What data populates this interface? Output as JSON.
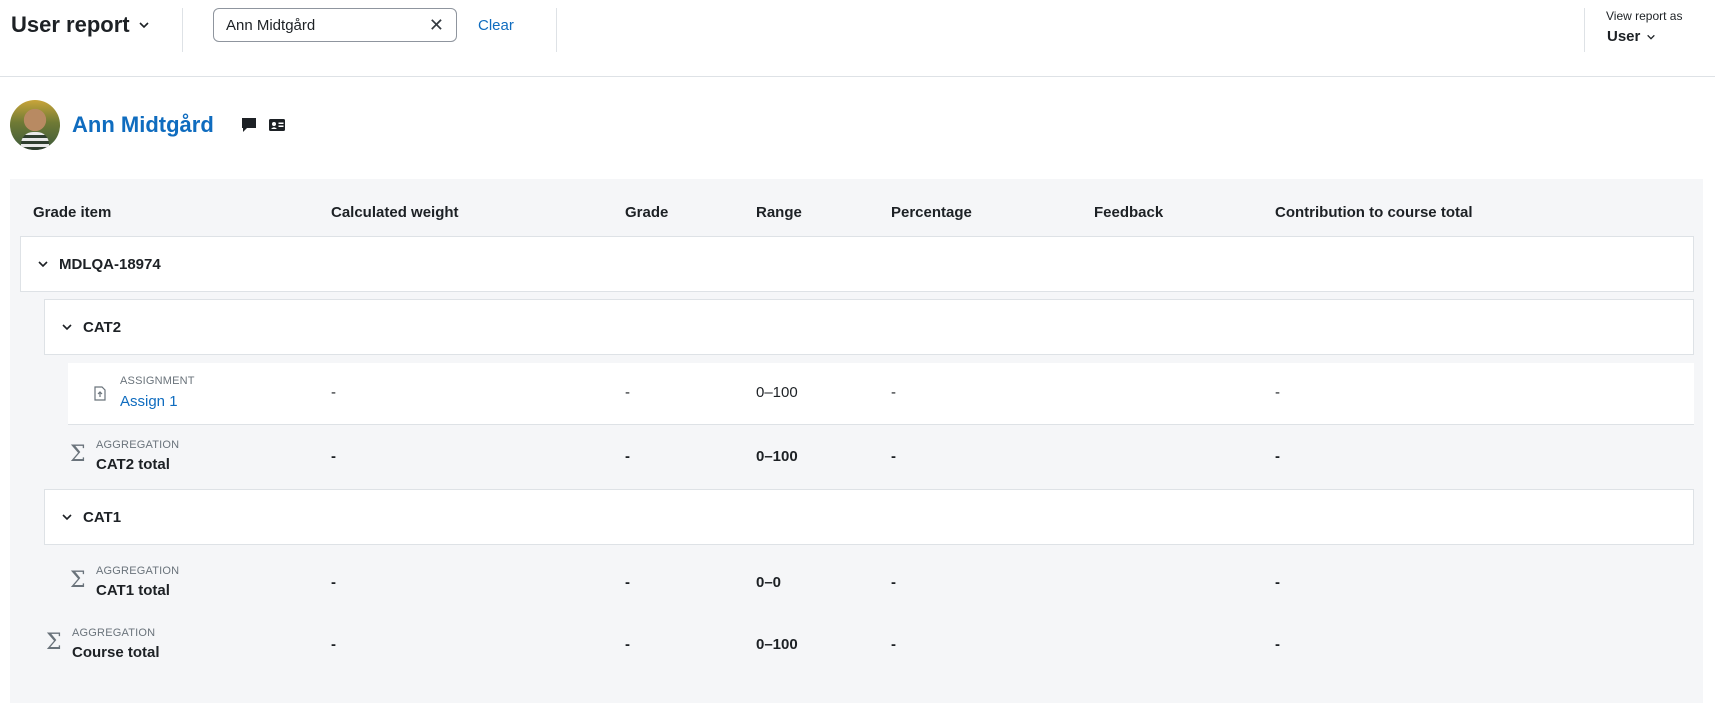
{
  "header": {
    "title": "User report",
    "search_value": "Ann Midtgård",
    "clear_label": "Clear",
    "view_as_label": "View report as",
    "view_as_value": "User"
  },
  "user": {
    "name": "Ann Midtgård"
  },
  "columns": [
    "Grade item",
    "Calculated weight",
    "Grade",
    "Range",
    "Percentage",
    "Feedback",
    "Contribution to course total"
  ],
  "categories": [
    {
      "name": "MDLQA-18974"
    },
    {
      "name": "CAT2"
    },
    {
      "name": "CAT1"
    }
  ],
  "rows": {
    "assign1": {
      "type": "ASSIGNMENT",
      "name": "Assign 1",
      "weight": "-",
      "grade": "-",
      "range": "0–100",
      "percentage": "-",
      "contribution": "-"
    },
    "cat2_total": {
      "type": "AGGREGATION",
      "name": "CAT2 total",
      "weight": "-",
      "grade": "-",
      "range": "0–100",
      "percentage": "-",
      "contribution": "-"
    },
    "cat1_total": {
      "type": "AGGREGATION",
      "name": "CAT1 total",
      "weight": "-",
      "grade": "-",
      "range": "0–0",
      "percentage": "-",
      "contribution": "-"
    },
    "course_total": {
      "type": "AGGREGATION",
      "name": "Course total",
      "weight": "-",
      "grade": "-",
      "range": "0–100",
      "percentage": "-",
      "contribution": "-"
    }
  },
  "icons": {
    "title_chevron": "chevron-down-icon",
    "clear_search": "close-icon",
    "message": "message-icon",
    "profile": "id-card-icon",
    "aggregation": "sigma-icon",
    "assignment": "assignment-icon"
  },
  "colors": {
    "link": "#0f6cbf",
    "panel": "#f5f6f8",
    "border": "#dee2e6"
  }
}
